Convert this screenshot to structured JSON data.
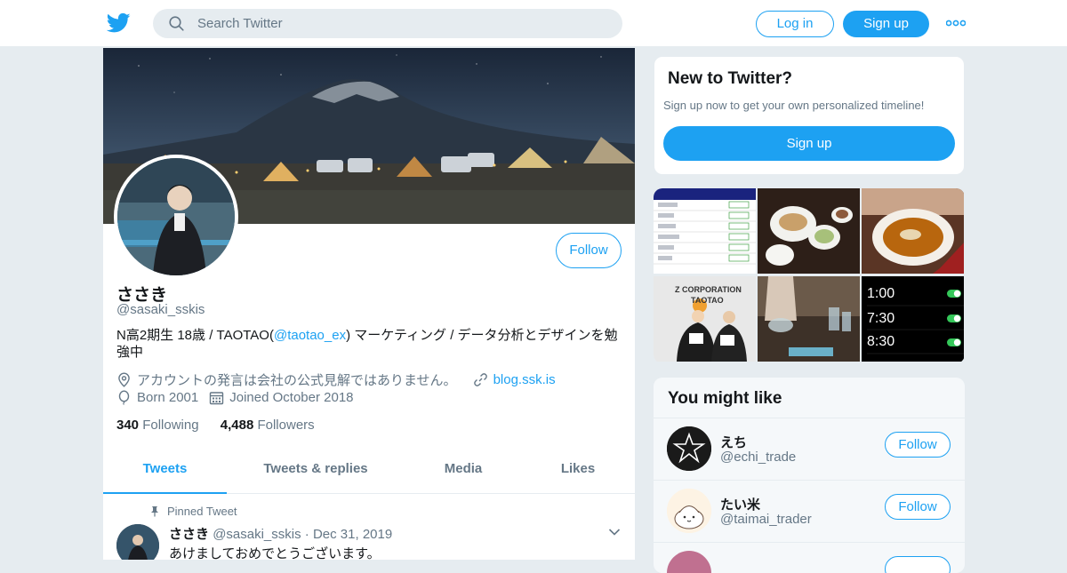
{
  "header": {
    "search_placeholder": "Search Twitter",
    "login_label": "Log in",
    "signup_label": "Sign up",
    "brand_color": "#1da1f2"
  },
  "profile": {
    "follow_label": "Follow",
    "name": "ささき",
    "handle": "@sasaki_sskis",
    "bio_prefix": "N高2期生 18歳 / TAOTAO(",
    "bio_link": "@taotao_ex",
    "bio_suffix": ") マーケティング / データ分析とデザインを勉強中",
    "location": "アカウントの発言は会社の公式見解ではありません。",
    "website": "blog.ssk.is",
    "born": "Born 2001",
    "joined": "Joined October 2018",
    "following_count": "340",
    "following_label": "Following",
    "followers_count": "4,488",
    "followers_label": "Followers"
  },
  "tabs": [
    {
      "label": "Tweets",
      "active": true
    },
    {
      "label": "Tweets & replies",
      "active": false
    },
    {
      "label": "Media",
      "active": false
    },
    {
      "label": "Likes",
      "active": false
    }
  ],
  "pinned_tweet": {
    "pinned_label": "Pinned Tweet",
    "name": "ささき",
    "handle": "@sasaki_sskis",
    "separator": "·",
    "date": "Dec 31, 2019",
    "text": "あけましておめでとうございます。"
  },
  "new_to_twitter": {
    "title": "New to Twitter?",
    "subtitle": "Sign up now to get your own personalized timeline!",
    "button_label": "Sign up"
  },
  "media_grid": {
    "tiles": [
      "screenshot",
      "food-table",
      "curry",
      "team-photo",
      "cafe",
      "alarm-screenshot"
    ],
    "overlay_texts": {
      "corp": "Z CORPORATION",
      "brand": "TAOTAO",
      "alarms": [
        "1:00",
        "7:30",
        "8:30"
      ]
    }
  },
  "you_might_like": {
    "title": "You might like",
    "users": [
      {
        "name": "えち",
        "handle": "@echi_trade",
        "follow_label": "Follow"
      },
      {
        "name": "たい米",
        "handle": "@taimai_trader",
        "follow_label": "Follow"
      }
    ]
  }
}
